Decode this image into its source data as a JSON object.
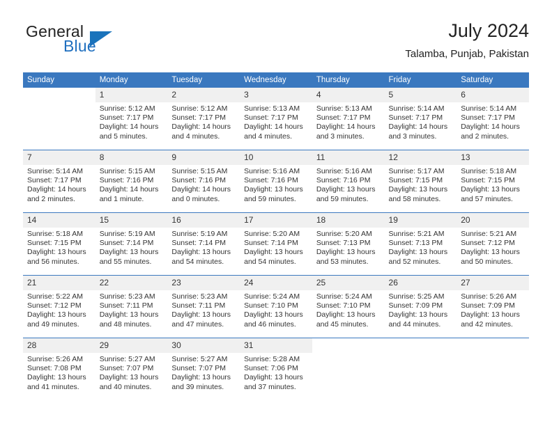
{
  "brand": {
    "name_part1": "General",
    "name_part2": "Blue",
    "triangle_color": "#1a73bb",
    "blue_color": "#1f6fbf"
  },
  "header": {
    "title": "July 2024",
    "subtitle": "Talamba, Punjab, Pakistan"
  },
  "theme": {
    "header_bg": "#3a78bf",
    "daynum_bg": "#f0f0f0",
    "separator": "#3a78bf"
  },
  "weekdays": [
    "Sunday",
    "Monday",
    "Tuesday",
    "Wednesday",
    "Thursday",
    "Friday",
    "Saturday"
  ],
  "weeks": [
    [
      {
        "day": "",
        "sunrise": "",
        "sunset": "",
        "daylight_l1": "",
        "daylight_l2": ""
      },
      {
        "day": "1",
        "sunrise": "Sunrise: 5:12 AM",
        "sunset": "Sunset: 7:17 PM",
        "daylight_l1": "Daylight: 14 hours",
        "daylight_l2": "and 5 minutes."
      },
      {
        "day": "2",
        "sunrise": "Sunrise: 5:12 AM",
        "sunset": "Sunset: 7:17 PM",
        "daylight_l1": "Daylight: 14 hours",
        "daylight_l2": "and 4 minutes."
      },
      {
        "day": "3",
        "sunrise": "Sunrise: 5:13 AM",
        "sunset": "Sunset: 7:17 PM",
        "daylight_l1": "Daylight: 14 hours",
        "daylight_l2": "and 4 minutes."
      },
      {
        "day": "4",
        "sunrise": "Sunrise: 5:13 AM",
        "sunset": "Sunset: 7:17 PM",
        "daylight_l1": "Daylight: 14 hours",
        "daylight_l2": "and 3 minutes."
      },
      {
        "day": "5",
        "sunrise": "Sunrise: 5:14 AM",
        "sunset": "Sunset: 7:17 PM",
        "daylight_l1": "Daylight: 14 hours",
        "daylight_l2": "and 3 minutes."
      },
      {
        "day": "6",
        "sunrise": "Sunrise: 5:14 AM",
        "sunset": "Sunset: 7:17 PM",
        "daylight_l1": "Daylight: 14 hours",
        "daylight_l2": "and 2 minutes."
      }
    ],
    [
      {
        "day": "7",
        "sunrise": "Sunrise: 5:14 AM",
        "sunset": "Sunset: 7:17 PM",
        "daylight_l1": "Daylight: 14 hours",
        "daylight_l2": "and 2 minutes."
      },
      {
        "day": "8",
        "sunrise": "Sunrise: 5:15 AM",
        "sunset": "Sunset: 7:16 PM",
        "daylight_l1": "Daylight: 14 hours",
        "daylight_l2": "and 1 minute."
      },
      {
        "day": "9",
        "sunrise": "Sunrise: 5:15 AM",
        "sunset": "Sunset: 7:16 PM",
        "daylight_l1": "Daylight: 14 hours",
        "daylight_l2": "and 0 minutes."
      },
      {
        "day": "10",
        "sunrise": "Sunrise: 5:16 AM",
        "sunset": "Sunset: 7:16 PM",
        "daylight_l1": "Daylight: 13 hours",
        "daylight_l2": "and 59 minutes."
      },
      {
        "day": "11",
        "sunrise": "Sunrise: 5:16 AM",
        "sunset": "Sunset: 7:16 PM",
        "daylight_l1": "Daylight: 13 hours",
        "daylight_l2": "and 59 minutes."
      },
      {
        "day": "12",
        "sunrise": "Sunrise: 5:17 AM",
        "sunset": "Sunset: 7:15 PM",
        "daylight_l1": "Daylight: 13 hours",
        "daylight_l2": "and 58 minutes."
      },
      {
        "day": "13",
        "sunrise": "Sunrise: 5:18 AM",
        "sunset": "Sunset: 7:15 PM",
        "daylight_l1": "Daylight: 13 hours",
        "daylight_l2": "and 57 minutes."
      }
    ],
    [
      {
        "day": "14",
        "sunrise": "Sunrise: 5:18 AM",
        "sunset": "Sunset: 7:15 PM",
        "daylight_l1": "Daylight: 13 hours",
        "daylight_l2": "and 56 minutes."
      },
      {
        "day": "15",
        "sunrise": "Sunrise: 5:19 AM",
        "sunset": "Sunset: 7:14 PM",
        "daylight_l1": "Daylight: 13 hours",
        "daylight_l2": "and 55 minutes."
      },
      {
        "day": "16",
        "sunrise": "Sunrise: 5:19 AM",
        "sunset": "Sunset: 7:14 PM",
        "daylight_l1": "Daylight: 13 hours",
        "daylight_l2": "and 54 minutes."
      },
      {
        "day": "17",
        "sunrise": "Sunrise: 5:20 AM",
        "sunset": "Sunset: 7:14 PM",
        "daylight_l1": "Daylight: 13 hours",
        "daylight_l2": "and 54 minutes."
      },
      {
        "day": "18",
        "sunrise": "Sunrise: 5:20 AM",
        "sunset": "Sunset: 7:13 PM",
        "daylight_l1": "Daylight: 13 hours",
        "daylight_l2": "and 53 minutes."
      },
      {
        "day": "19",
        "sunrise": "Sunrise: 5:21 AM",
        "sunset": "Sunset: 7:13 PM",
        "daylight_l1": "Daylight: 13 hours",
        "daylight_l2": "and 52 minutes."
      },
      {
        "day": "20",
        "sunrise": "Sunrise: 5:21 AM",
        "sunset": "Sunset: 7:12 PM",
        "daylight_l1": "Daylight: 13 hours",
        "daylight_l2": "and 50 minutes."
      }
    ],
    [
      {
        "day": "21",
        "sunrise": "Sunrise: 5:22 AM",
        "sunset": "Sunset: 7:12 PM",
        "daylight_l1": "Daylight: 13 hours",
        "daylight_l2": "and 49 minutes."
      },
      {
        "day": "22",
        "sunrise": "Sunrise: 5:23 AM",
        "sunset": "Sunset: 7:11 PM",
        "daylight_l1": "Daylight: 13 hours",
        "daylight_l2": "and 48 minutes."
      },
      {
        "day": "23",
        "sunrise": "Sunrise: 5:23 AM",
        "sunset": "Sunset: 7:11 PM",
        "daylight_l1": "Daylight: 13 hours",
        "daylight_l2": "and 47 minutes."
      },
      {
        "day": "24",
        "sunrise": "Sunrise: 5:24 AM",
        "sunset": "Sunset: 7:10 PM",
        "daylight_l1": "Daylight: 13 hours",
        "daylight_l2": "and 46 minutes."
      },
      {
        "day": "25",
        "sunrise": "Sunrise: 5:24 AM",
        "sunset": "Sunset: 7:10 PM",
        "daylight_l1": "Daylight: 13 hours",
        "daylight_l2": "and 45 minutes."
      },
      {
        "day": "26",
        "sunrise": "Sunrise: 5:25 AM",
        "sunset": "Sunset: 7:09 PM",
        "daylight_l1": "Daylight: 13 hours",
        "daylight_l2": "and 44 minutes."
      },
      {
        "day": "27",
        "sunrise": "Sunrise: 5:26 AM",
        "sunset": "Sunset: 7:09 PM",
        "daylight_l1": "Daylight: 13 hours",
        "daylight_l2": "and 42 minutes."
      }
    ],
    [
      {
        "day": "28",
        "sunrise": "Sunrise: 5:26 AM",
        "sunset": "Sunset: 7:08 PM",
        "daylight_l1": "Daylight: 13 hours",
        "daylight_l2": "and 41 minutes."
      },
      {
        "day": "29",
        "sunrise": "Sunrise: 5:27 AM",
        "sunset": "Sunset: 7:07 PM",
        "daylight_l1": "Daylight: 13 hours",
        "daylight_l2": "and 40 minutes."
      },
      {
        "day": "30",
        "sunrise": "Sunrise: 5:27 AM",
        "sunset": "Sunset: 7:07 PM",
        "daylight_l1": "Daylight: 13 hours",
        "daylight_l2": "and 39 minutes."
      },
      {
        "day": "31",
        "sunrise": "Sunrise: 5:28 AM",
        "sunset": "Sunset: 7:06 PM",
        "daylight_l1": "Daylight: 13 hours",
        "daylight_l2": "and 37 minutes."
      },
      {
        "day": "",
        "sunrise": "",
        "sunset": "",
        "daylight_l1": "",
        "daylight_l2": ""
      },
      {
        "day": "",
        "sunrise": "",
        "sunset": "",
        "daylight_l1": "",
        "daylight_l2": ""
      },
      {
        "day": "",
        "sunrise": "",
        "sunset": "",
        "daylight_l1": "",
        "daylight_l2": ""
      }
    ]
  ]
}
